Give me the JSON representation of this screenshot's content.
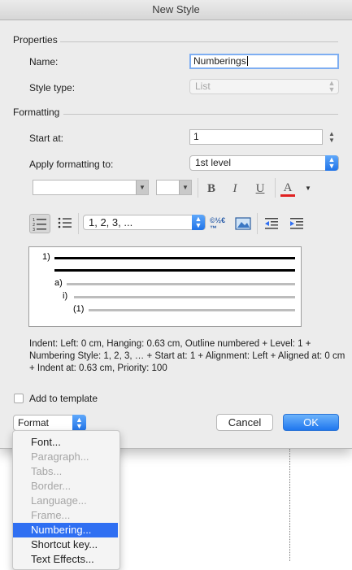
{
  "dialog": {
    "title": "New Style",
    "properties_label": "Properties",
    "name_label": "Name:",
    "name_value": "Numberings",
    "style_type_label": "Style type:",
    "style_type_value": "List",
    "formatting_label": "Formatting",
    "start_at_label": "Start at:",
    "start_at_value": "1",
    "apply_label": "Apply formatting to:",
    "apply_value": "1st level",
    "bold_label": "B",
    "italic_label": "I",
    "underline_label": "U",
    "font_color_label": "A",
    "numbering_format_value": "1, 2, 3, ...",
    "symbol_icon_label": "©½€™",
    "preview": {
      "levels": [
        "1)",
        "a)",
        "i)",
        "(1)"
      ]
    },
    "description": "Indent: Left:  0 cm, Hanging:  0.63 cm, Outline numbered + Level: 1 + Numbering Style: 1, 2, 3, … + Start at: 1 + Alignment: Left + Aligned at:  0 cm + Indent at:  0.63 cm, Priority: 100",
    "add_to_template_label": "Add to template",
    "format_button_label": "Format",
    "cancel_label": "Cancel",
    "ok_label": "OK"
  },
  "format_menu": {
    "items": [
      {
        "label": "Font...",
        "state": "enabled"
      },
      {
        "label": "Paragraph...",
        "state": "disabled"
      },
      {
        "label": "Tabs...",
        "state": "disabled"
      },
      {
        "label": "Border...",
        "state": "disabled"
      },
      {
        "label": "Language...",
        "state": "disabled"
      },
      {
        "label": "Frame...",
        "state": "disabled"
      },
      {
        "label": "Numbering...",
        "state": "highlighted"
      },
      {
        "label": "Shortcut key...",
        "state": "enabled"
      },
      {
        "label": "Text Effects...",
        "state": "enabled"
      }
    ]
  },
  "colors": {
    "accent": "#2f6ff2",
    "font_color_bar": "#e02020"
  }
}
